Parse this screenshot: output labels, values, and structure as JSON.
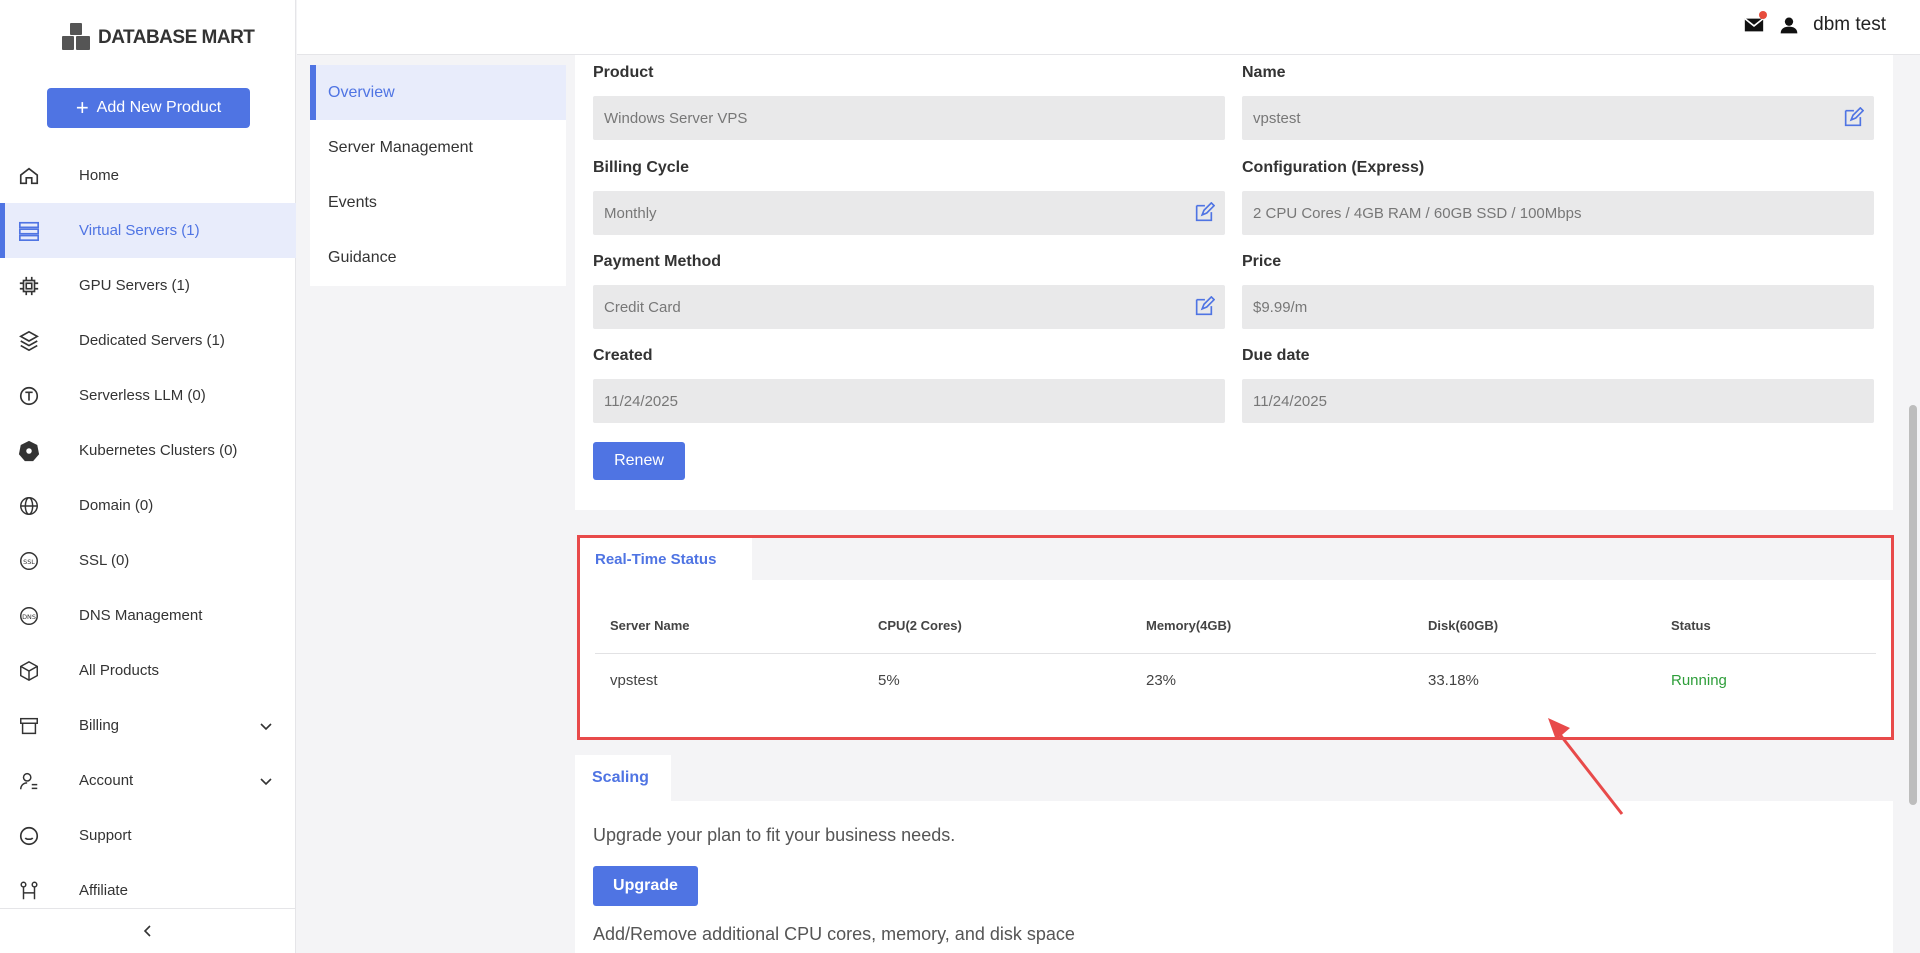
{
  "brand": {
    "name": "DATABASE MART"
  },
  "sidebar": {
    "add_button": "Add New Product",
    "items": [
      {
        "label": "Home",
        "icon": "home-icon"
      },
      {
        "label": "Virtual Servers (1)",
        "icon": "server-icon"
      },
      {
        "label": "GPU Servers (1)",
        "icon": "chip-icon"
      },
      {
        "label": "Dedicated Servers (1)",
        "icon": "cube-stack-icon"
      },
      {
        "label": "Serverless LLM (0)",
        "icon": "llm-icon"
      },
      {
        "label": "Kubernetes Clusters (0)",
        "icon": "kubernetes-icon"
      },
      {
        "label": "Domain (0)",
        "icon": "globe-icon"
      },
      {
        "label": "SSL (0)",
        "icon": "ssl-icon"
      },
      {
        "label": "DNS Management",
        "icon": "dns-icon"
      },
      {
        "label": "All Products",
        "icon": "box-icon"
      },
      {
        "label": "Billing",
        "icon": "billing-icon"
      },
      {
        "label": "Account",
        "icon": "account-icon"
      },
      {
        "label": "Support",
        "icon": "support-icon"
      },
      {
        "label": "Affiliate",
        "icon": "affiliate-icon"
      }
    ],
    "active_index": 1
  },
  "header": {
    "username": "dbm test"
  },
  "submenu": {
    "items": [
      "Overview",
      "Server Management",
      "Events",
      "Guidance"
    ]
  },
  "details": {
    "product_label": "Product",
    "product_value": "Windows Server VPS",
    "name_label": "Name",
    "name_value": "vpstest",
    "billing_cycle_label": "Billing Cycle",
    "billing_cycle_value": "Monthly",
    "config_label": "Configuration (Express)",
    "config_value": "2 CPU Cores / 4GB RAM / 60GB SSD / 100Mbps",
    "payment_label": "Payment Method",
    "payment_value": "Credit Card",
    "price_label": "Price",
    "price_value": "$9.99/m",
    "created_label": "Created",
    "created_value": "11/24/2025",
    "due_label": "Due date",
    "due_value": "11/24/2025",
    "renew_button": "Renew"
  },
  "status": {
    "tab": "Real-Time Status",
    "columns": [
      "Server Name",
      "CPU(2 Cores)",
      "Memory(4GB)",
      "Disk(60GB)",
      "Status"
    ],
    "row": [
      "vpstest",
      "5%",
      "23%",
      "33.18%",
      "Running"
    ]
  },
  "scaling": {
    "tab": "Scaling",
    "text": "Upgrade your plan to fit your business needs.",
    "upgrade_button": "Upgrade",
    "text2": "Add/Remove additional CPU cores, memory, and disk space"
  },
  "colors": {
    "accent": "#4f74e3",
    "highlight_border": "#e84a4a",
    "running": "#2e9e3a"
  }
}
